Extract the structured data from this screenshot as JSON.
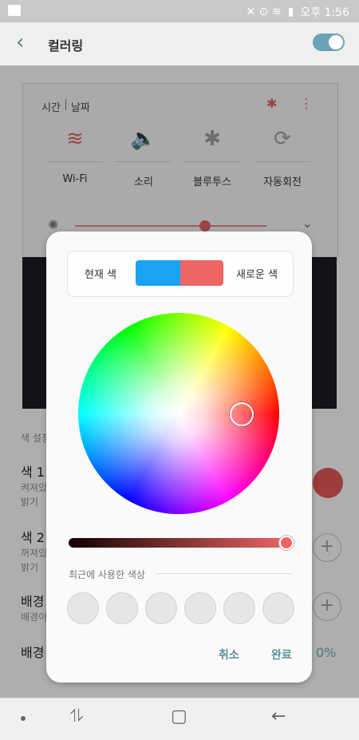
{
  "status_bar": {
    "time": "오후 1:56",
    "battery": "▮",
    "icons": "✕ ⊙ ≋"
  },
  "app_bar": {
    "back_icon": "back-arrow-icon",
    "title": "컬러링",
    "toggle_on": true
  },
  "panel": {
    "tab1": "시간",
    "tab2": "날짜",
    "quick": [
      {
        "label": "Wi-Fi",
        "icon": "≋"
      },
      {
        "label": "소리",
        "icon": "🔈"
      },
      {
        "label": "블루투스",
        "icon": "✱"
      },
      {
        "label": "자동회전",
        "icon": "⟳"
      }
    ],
    "brightness_level": 0.58
  },
  "list": {
    "section": "색 설정",
    "item1_title": "색 1",
    "item1_sub1": "켜져있",
    "item1_sub2": "밝기",
    "item2_title": "색 2",
    "item2_sub1": "꺼져있",
    "item2_sub2": "밝기",
    "item3_title": "배경",
    "item3_sub": "배경이",
    "item4_title": "배경",
    "percent": "0%",
    "plus": "+"
  },
  "dialog": {
    "current_label": "현재 색",
    "new_label": "새로운 색",
    "current_color": "#1aa3f0",
    "new_color": "#ee6565",
    "recent_label": "최근에 사용한 색상",
    "cancel": "취소",
    "done": "완료",
    "value_level": 0.96
  },
  "nav": {
    "recent_icon": "⥮",
    "home_icon": "▢",
    "back_icon": "←"
  }
}
